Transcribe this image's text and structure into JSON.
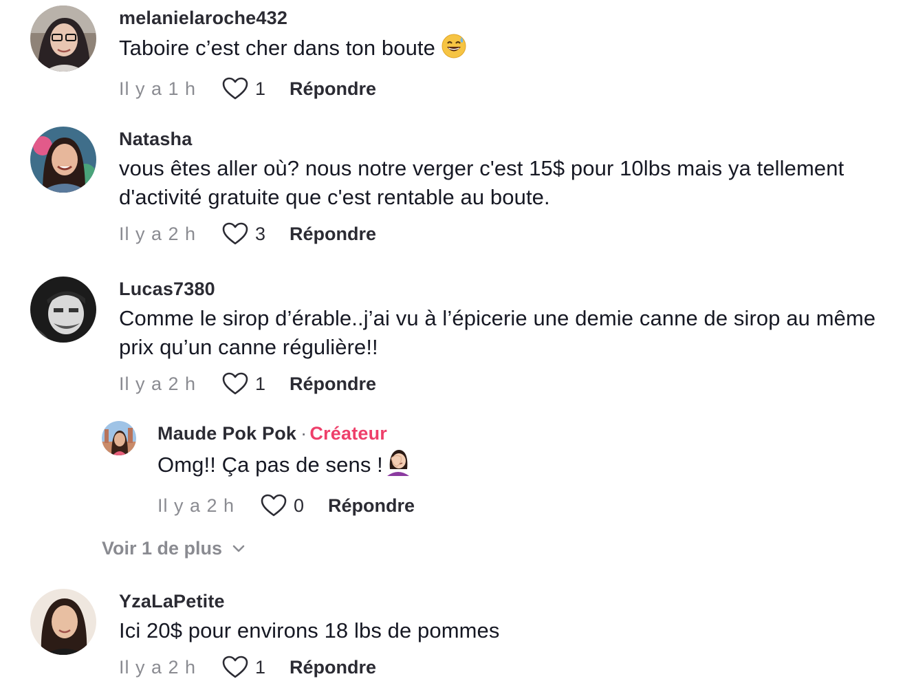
{
  "comments": [
    {
      "username": "melanielaroche432",
      "text": "Taboire c’est cher dans ton boute",
      "emoji": "sweat-smile-emoji",
      "time": "Il y a 1 h",
      "likes": "1",
      "reply_label": "Répondre"
    },
    {
      "username": "Natasha",
      "text": "vous êtes aller où? nous notre verger c'est 15$ pour 10lbs mais ya tellement d'activité gratuite que c'est rentable au boute.",
      "time": "Il y a 2 h",
      "likes": "3",
      "reply_label": "Répondre"
    },
    {
      "username": "Lucas7380",
      "text": "Comme le sirop d’érable..j’ai vu à l’épicerie une demie canne de sirop au même prix qu’un canne régulière!!",
      "time": "Il y a 2 h",
      "likes": "1",
      "reply_label": "Répondre"
    },
    {
      "username": "Maude Pok Pok",
      "separator": "·",
      "badge": "Créateur",
      "text": "Omg!! Ça pas de sens !",
      "emoji": "woman-facepalming-emoji",
      "time": "Il y a 2 h",
      "likes": "0",
      "reply_label": "Répondre"
    },
    {
      "username": "YzaLaPetite",
      "text": "Ici 20$ pour environs 18 lbs de pommes",
      "time": "Il y a 2 h",
      "likes": "1",
      "reply_label": "Répondre"
    }
  ],
  "see_more_label": "Voir 1 de plus",
  "colors": {
    "creator_badge": "#ee3f6a",
    "meta_text": "#8a8b91",
    "primary_text": "#161823"
  }
}
